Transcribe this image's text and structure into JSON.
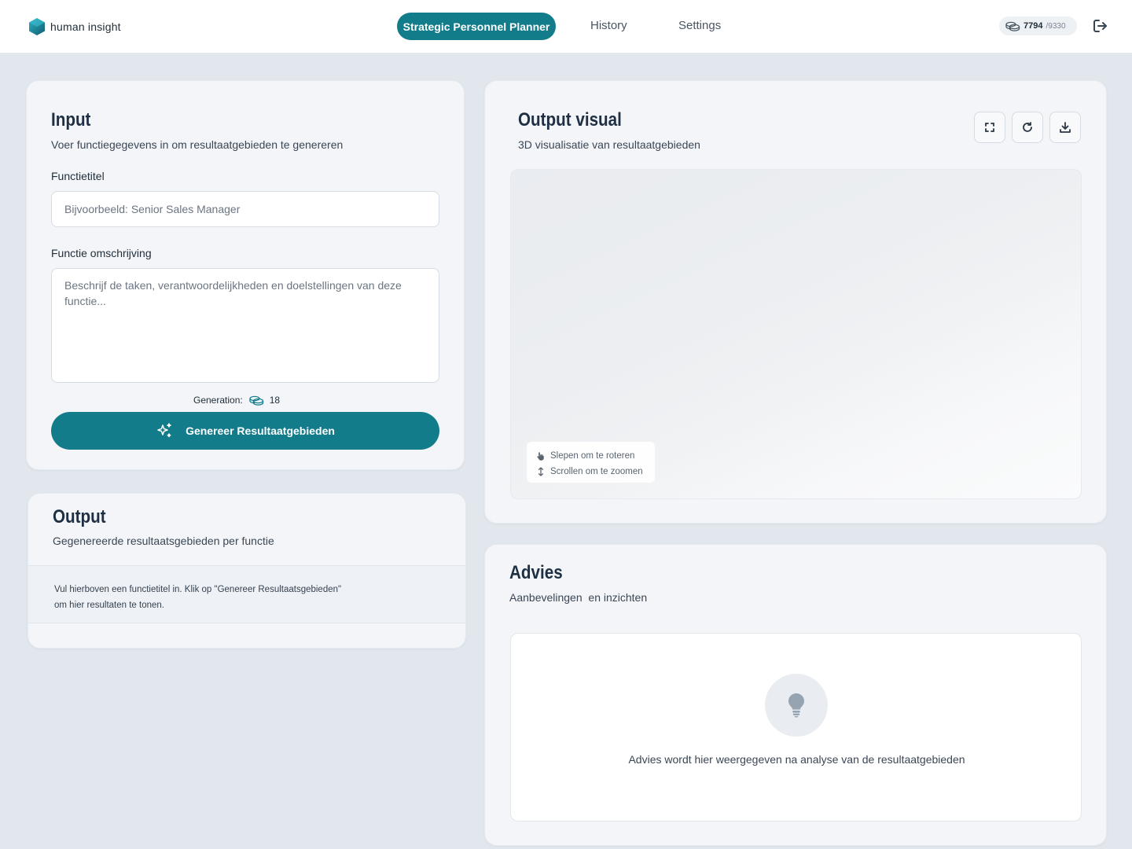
{
  "header": {
    "brand": "human insight",
    "nav_active": "Strategic Personnel Planner",
    "nav_history": "History",
    "nav_settings": "Settings",
    "credits_used": "7794",
    "credits_total": "/9330",
    "accent_color": "#137c8b"
  },
  "input": {
    "title": "Input",
    "subtitle": "Voer functiegegevens in om resultaatgebieden te genereren",
    "job_title_label": "Functietitel",
    "job_title_placeholder": "Bijvoorbeeld: Senior Sales Manager",
    "job_title_value": "",
    "description_label": "Functie omschrijving",
    "description_placeholder": "Beschrijf de taken, verantwoordelijkheden en doelstellingen van deze functie...",
    "description_value": "",
    "generation_label": "Generation:",
    "generation_cost": "18",
    "generate_button": "Genereer Resultaatgebieden"
  },
  "output": {
    "title": "Output",
    "subtitle": "Gegenereerde resultaatsgebieden per functie",
    "empty_line1": "Vul hierboven een functietitel in. Klik op \"Genereer Resultaatsgebieden\"",
    "empty_line2": "om hier resultaten te tonen."
  },
  "visual": {
    "title": "Output visual",
    "subtitle": "3D visualisatie van resultaatgebieden",
    "hint_rotate": "Slepen om te roteren",
    "hint_zoom": "Scrollen om te zoomen",
    "icons": [
      "fullscreen-icon",
      "refresh-icon",
      "download-icon"
    ]
  },
  "advies": {
    "title": "Advies",
    "subtitle": "Aanbevelingen  en inzichten",
    "empty_message": "Advies wordt hier weergegeven na analyse van de resultaatgebieden"
  }
}
